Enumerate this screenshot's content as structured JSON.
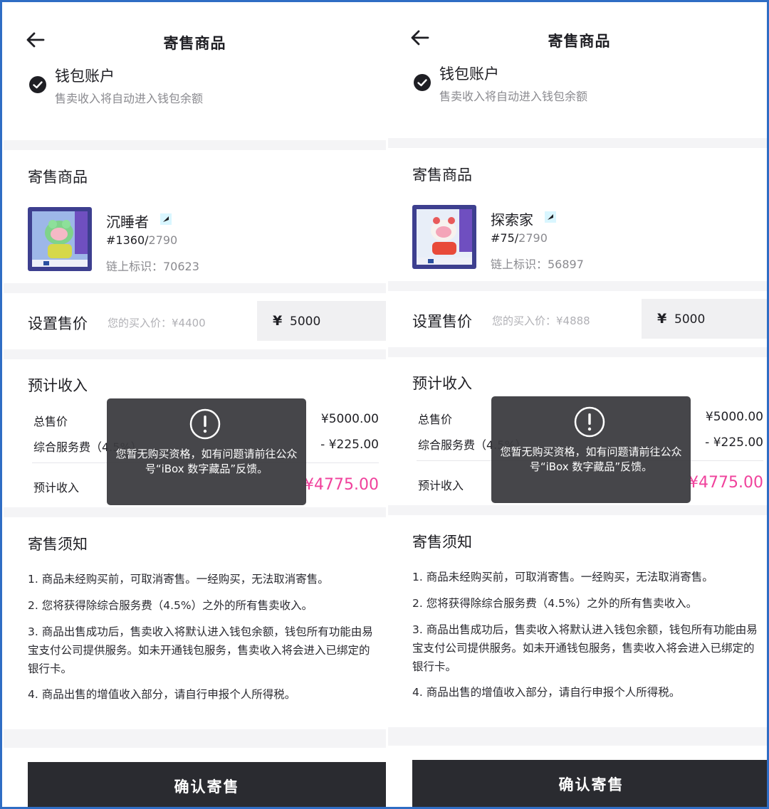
{
  "screens": [
    {
      "header": {
        "title": "寄售商品"
      },
      "wallet": {
        "title": "钱包账户",
        "subtitle": "售卖收入将自动进入钱包余额"
      },
      "product": {
        "section_title": "寄售商品",
        "name": "沉睡者",
        "serial_no": "#1360/",
        "serial_total": "2790",
        "chain_id": "链上标识：70623"
      },
      "price": {
        "label": "设置售价",
        "hint": "您的买入价：¥4400",
        "currency": "¥",
        "value": "5000"
      },
      "income": {
        "title": "预计收入",
        "total_label": "总售价",
        "total_value": "¥5000.00",
        "fee_label": "综合服务费（4.5%）",
        "fee_value": "- ¥225.00",
        "expected_label": "预计收入",
        "expected_value": "¥4775.00"
      },
      "toast": {
        "message": "您暂无购买资格，如有问题请前往公众号“iBox 数字藏品”反馈。"
      },
      "notice": {
        "title": "寄售须知",
        "items": [
          "1. 商品未经购买前，可取消寄售。一经购买，无法取消寄售。",
          "2. 您将获得除综合服务费（4.5%）之外的所有售卖收入。",
          "3. 商品出售成功后，售卖收入将默认进入钱包余额，钱包所有功能由易宝支付公司提供服务。如未开通钱包服务，售卖收入将会进入已绑定的银行卡。",
          "4. 商品出售的增值收入部分，请自行申报个人所得税。"
        ]
      },
      "confirm": {
        "label": "确认寄售"
      }
    },
    {
      "header": {
        "title": "寄售商品"
      },
      "wallet": {
        "title": "钱包账户",
        "subtitle": "售卖收入将自动进入钱包余额"
      },
      "product": {
        "section_title": "寄售商品",
        "name": "探索家",
        "serial_no": "#75/",
        "serial_total": "2790",
        "chain_id": "链上标识：56897"
      },
      "price": {
        "label": "设置售价",
        "hint": "您的买入价：¥4888",
        "currency": "¥",
        "value": "5000"
      },
      "income": {
        "title": "预计收入",
        "total_label": "总售价",
        "total_value": "¥5000.00",
        "fee_label": "综合服务费（4.5%）",
        "fee_value": "- ¥225.00",
        "expected_label": "预计收入",
        "expected_value": "¥4775.00"
      },
      "toast": {
        "message": "您暂无购买资格，如有问题请前往公众号“iBox 数字藏品”反馈。"
      },
      "notice": {
        "title": "寄售须知",
        "items": [
          "1. 商品未经购买前，可取消寄售。一经购买，无法取消寄售。",
          "2. 您将获得除综合服务费（4.5%）之外的所有售卖收入。",
          "3. 商品出售成功后，售卖收入将默认进入钱包余额，钱包所有功能由易宝支付公司提供服务。如未开通钱包服务，售卖收入将会进入已绑定的银行卡。",
          "4. 商品出售的增值收入部分，请自行申报个人所得税。"
        ]
      },
      "confirm": {
        "label": "确认寄售"
      }
    }
  ],
  "colors": {
    "accent_pink": "#f0429c",
    "button_dark": "#2a2b30",
    "frame_blue": "#2f6dc4"
  },
  "icons": {
    "back": "arrow-left-icon",
    "check": "check-circle-icon",
    "verified": "verified-badge-icon",
    "toast": "exclamation-circle-icon"
  }
}
